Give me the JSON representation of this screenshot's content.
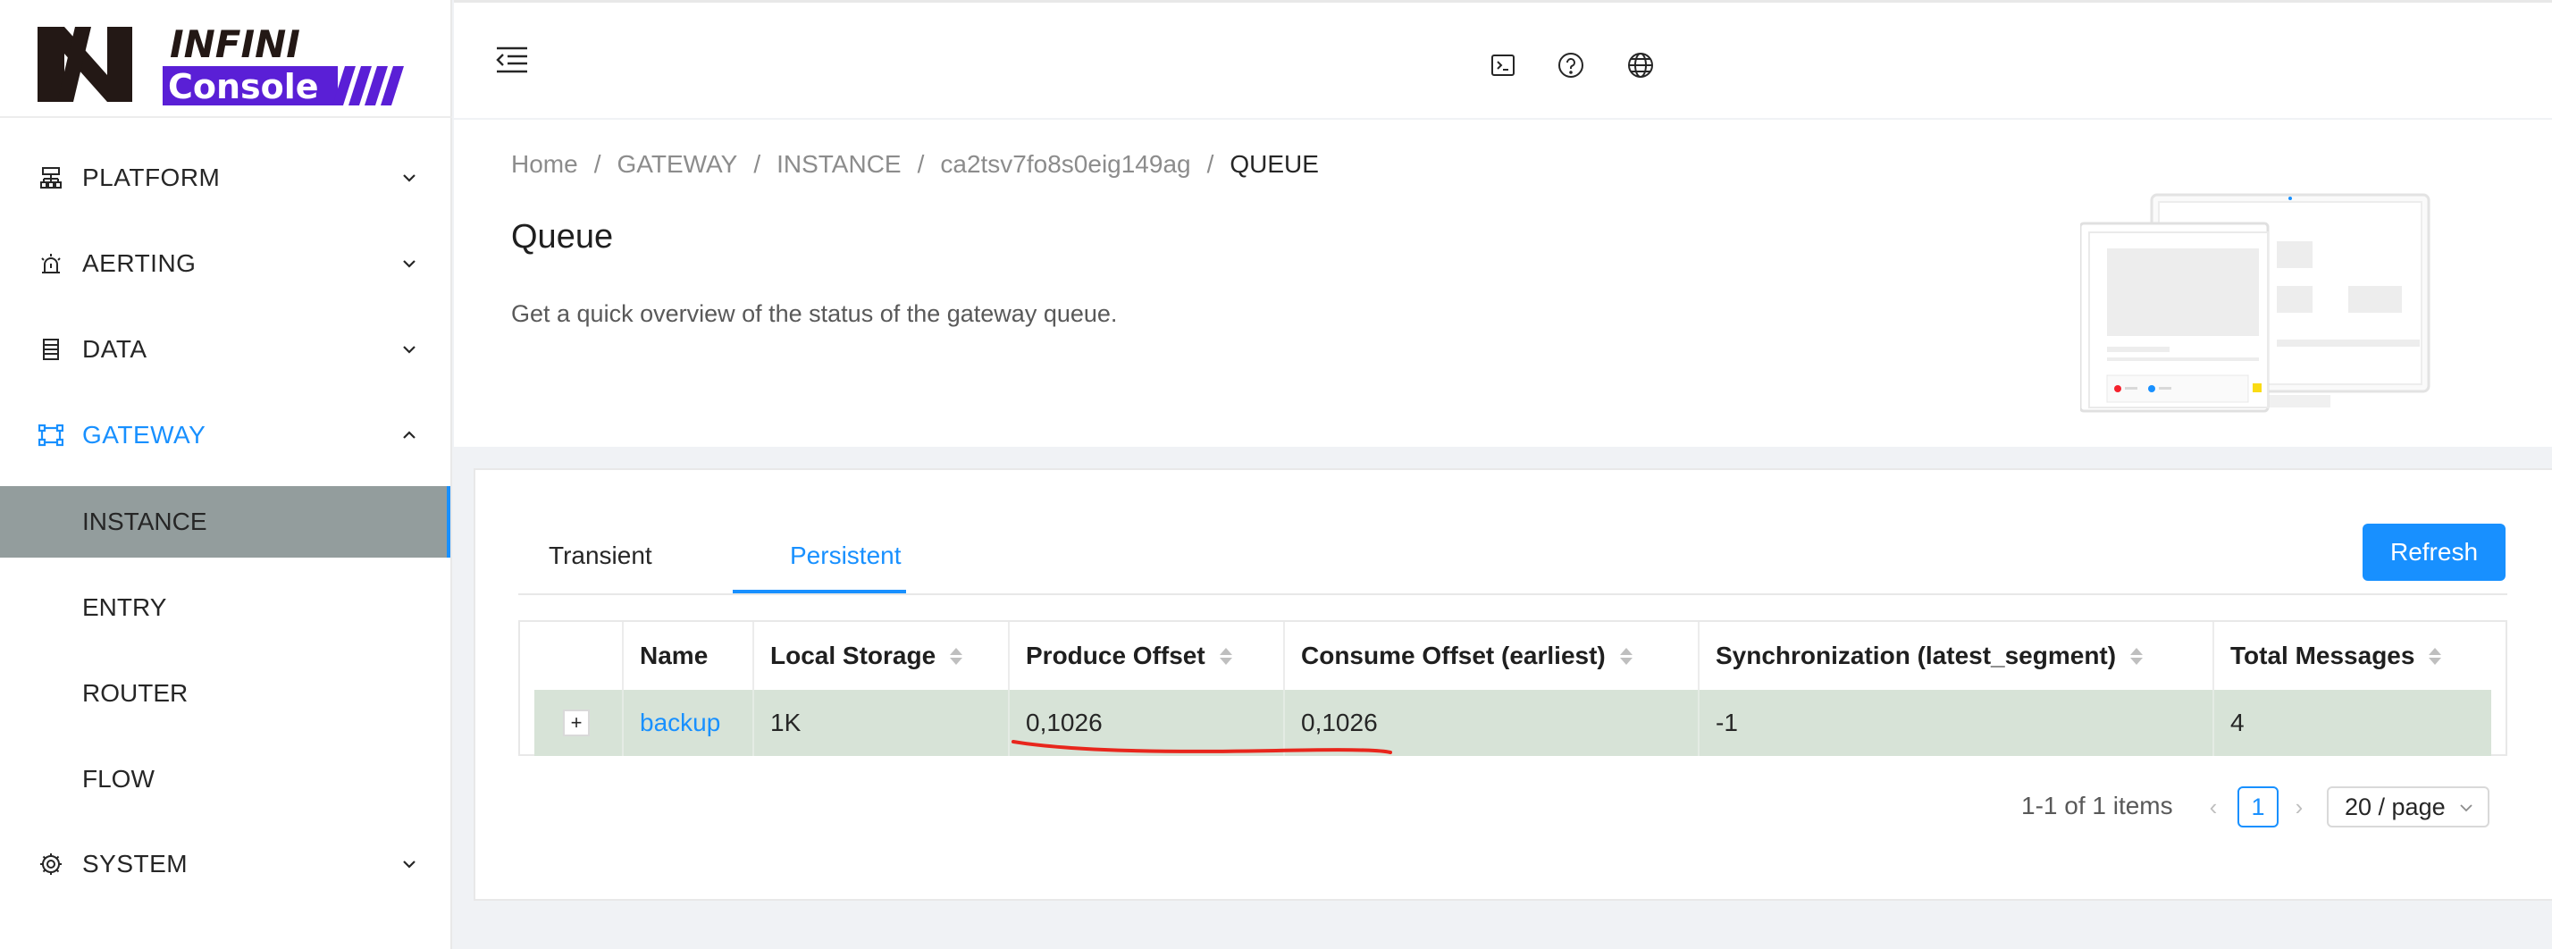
{
  "app": {
    "logo_text_top": "INFINI",
    "logo_text_bottom": "Console"
  },
  "sidebar": {
    "items": [
      {
        "label": "PLATFORM",
        "icon": "platform-icon"
      },
      {
        "label": "AERTING",
        "icon": "alarm-icon"
      },
      {
        "label": "DATA",
        "icon": "data-icon"
      },
      {
        "label": "GATEWAY",
        "icon": "gateway-icon"
      },
      {
        "label": "SYSTEM",
        "icon": "gear-icon"
      }
    ],
    "gateway_subitems": [
      "INSTANCE",
      "ENTRY",
      "ROUTER",
      "FLOW"
    ],
    "selected_subitem": "INSTANCE"
  },
  "header": {
    "icons": [
      "menu-fold-icon",
      "terminal-icon",
      "help-icon",
      "globe-icon"
    ]
  },
  "breadcrumb": [
    "Home",
    "GATEWAY",
    "INSTANCE",
    "ca2tsv7fo8s0eig149ag",
    "QUEUE"
  ],
  "page": {
    "title": "Queue",
    "description": "Get a quick overview of the status of the gateway queue."
  },
  "tabs": [
    {
      "label": "Transient",
      "active": false
    },
    {
      "label": "Persistent",
      "active": true
    }
  ],
  "refresh_label": "Refresh",
  "table": {
    "columns": [
      "Name",
      "Local Storage",
      "Produce Offset",
      "Consume Offset (earliest)",
      "Synchronization (latest_segment)",
      "Total Messages"
    ],
    "rows": [
      {
        "expand": "+",
        "name": "backup",
        "local_storage": "1K",
        "produce_offset": "0,1026",
        "consume_offset": "0,1026",
        "synchronization": "-1",
        "total_messages": "4"
      }
    ]
  },
  "pagination": {
    "total_text": "1-1 of 1 items",
    "current_page": "1",
    "page_size": "20 / page"
  },
  "colors": {
    "primary": "#1890ff",
    "logo_purple": "#5a1fd6",
    "selected_menu_bg": "#939d9d",
    "row_highlight": "#d7e3d7",
    "annotation_red": "#e8261c"
  }
}
